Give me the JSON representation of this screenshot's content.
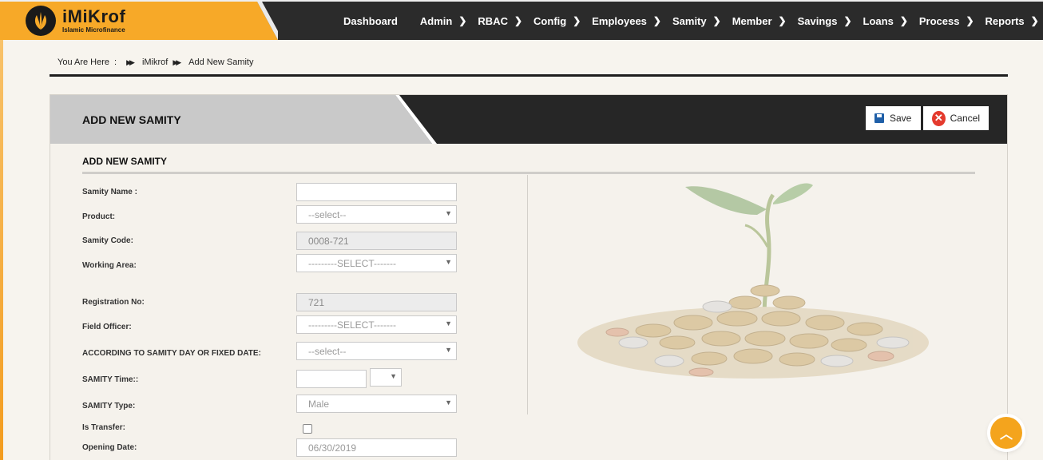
{
  "brand": {
    "name": "iMiKrof",
    "tagline": "Islamic Microfinance",
    "accent": "#f4a41d",
    "dark": "#2b2b2b"
  },
  "nav": [
    {
      "label": "Dashboard",
      "has_submenu": false
    },
    {
      "label": "Admin",
      "has_submenu": true
    },
    {
      "label": "RBAC",
      "has_submenu": true
    },
    {
      "label": "Config",
      "has_submenu": true
    },
    {
      "label": "Employees",
      "has_submenu": true
    },
    {
      "label": "Samity",
      "has_submenu": true
    },
    {
      "label": "Member",
      "has_submenu": true
    },
    {
      "label": "Savings",
      "has_submenu": true
    },
    {
      "label": "Loans",
      "has_submenu": true
    },
    {
      "label": "Process",
      "has_submenu": true
    },
    {
      "label": "Reports",
      "has_submenu": true
    }
  ],
  "breadcrumb": {
    "prefix": "You Are Here",
    "separator": ":",
    "items": [
      "iMikrof",
      "Add New Samity"
    ]
  },
  "panel": {
    "title": "ADD NEW SAMITY",
    "save_label": "Save",
    "cancel_label": "Cancel",
    "section_title": "ADD NEW SAMITY"
  },
  "form": {
    "samity_name": {
      "label": "Samity Name :",
      "value": ""
    },
    "product": {
      "label": "Product:",
      "value": "--select--"
    },
    "samity_code": {
      "label": "Samity Code:",
      "value": "0008-721"
    },
    "working_area": {
      "label": "Working Area:",
      "value": "---------SELECT-------"
    },
    "registration_no": {
      "label": "Registration No:",
      "value": "721"
    },
    "field_officer": {
      "label": "Field Officer:",
      "value": "---------SELECT-------"
    },
    "samity_day": {
      "label": "ACCORDING TO SAMITY DAY OR FIXED DATE:",
      "value": "--select--"
    },
    "samity_time": {
      "label": "SAMITY Time::",
      "value": "",
      "period": ""
    },
    "samity_type": {
      "label": "SAMITY Type:",
      "value": "Male"
    },
    "is_transfer": {
      "label": "Is Transfer:",
      "checked": false
    },
    "opening_date": {
      "label": "Opening Date:",
      "value": "06/30/2019"
    }
  },
  "icons": {
    "save": "floppy-disk-icon",
    "cancel": "x-circle-icon",
    "scroll_top": "chevron-up-icon",
    "illustration": "plant-coins-image"
  }
}
